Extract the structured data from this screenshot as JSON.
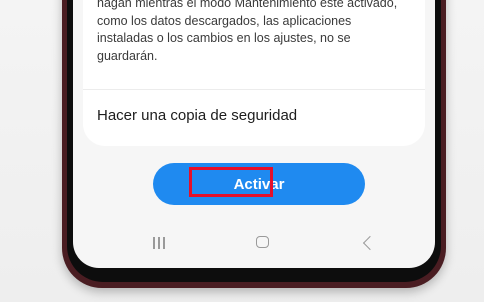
{
  "screen": {
    "info_text": "hagan mientras el modo Mantenimiento esté activado, como los datos descargados, las aplicaciones instaladas o los cambios en los ajustes, no se guardarán.",
    "backup_option_label": "Hacer una copia de seguridad",
    "activate_button_label": "Activar"
  },
  "navbar": {
    "recent_apps_icon": "recent-apps-icon",
    "home_icon": "home-icon",
    "back_icon": "back-icon"
  },
  "colors": {
    "button_blue": "#1f8af0",
    "highlight_red": "#e5102a",
    "phone_frame": "#4a1d22"
  }
}
